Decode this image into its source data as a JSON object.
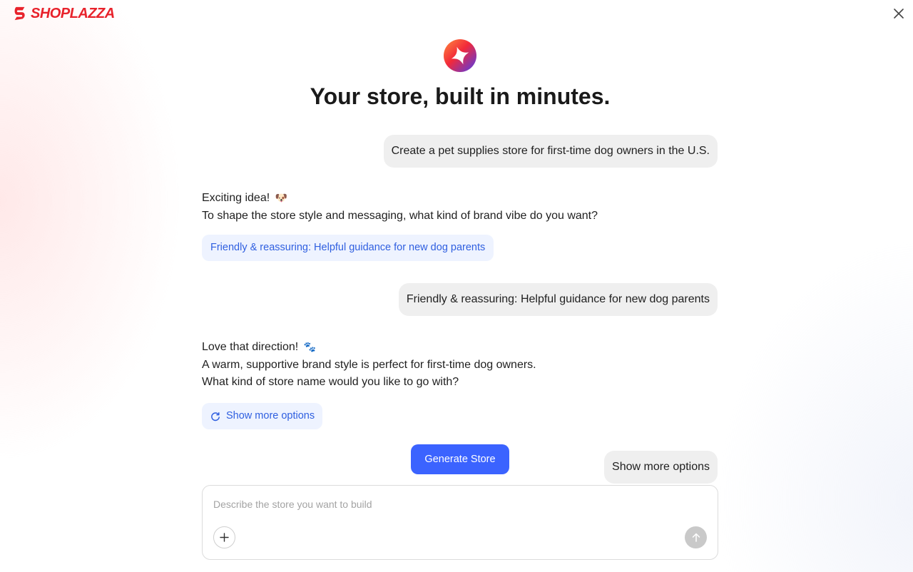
{
  "brand": {
    "name": "SHOPLAZZA",
    "color": "#e8222b",
    "logo_icon": "shoplazza-logo-icon"
  },
  "header": {
    "close_icon": "close-icon"
  },
  "hero": {
    "icon": "sparkle-star-icon",
    "title": "Your store, built in minutes."
  },
  "conversation": {
    "user_message_1": "Create a pet supplies store for first-time dog owners in the U.S.",
    "ai_message_1": {
      "line1": "Exciting idea! ",
      "emoji1": "🐶",
      "line2": "To shape the store style and messaging, what kind of brand vibe do you want?"
    },
    "suggestion_1": "Friendly & reassuring: Helpful guidance for new dog parents",
    "user_message_2": "Friendly & reassuring: Helpful guidance for new dog parents",
    "ai_message_2": {
      "line1": "Love that direction! ",
      "emoji1": "🐾",
      "line2": "A warm, supportive brand style is perfect for first-time dog owners.",
      "line3": "What kind of store name would you like to go with?"
    },
    "show_more_chip": "Show more options",
    "user_message_3": "Show more options"
  },
  "actions": {
    "generate_label": "Generate Store",
    "accent": "#3b63ff"
  },
  "composer": {
    "placeholder": "Describe the store you want to build",
    "plus_icon": "plus-icon",
    "send_icon": "arrow-up-icon"
  }
}
